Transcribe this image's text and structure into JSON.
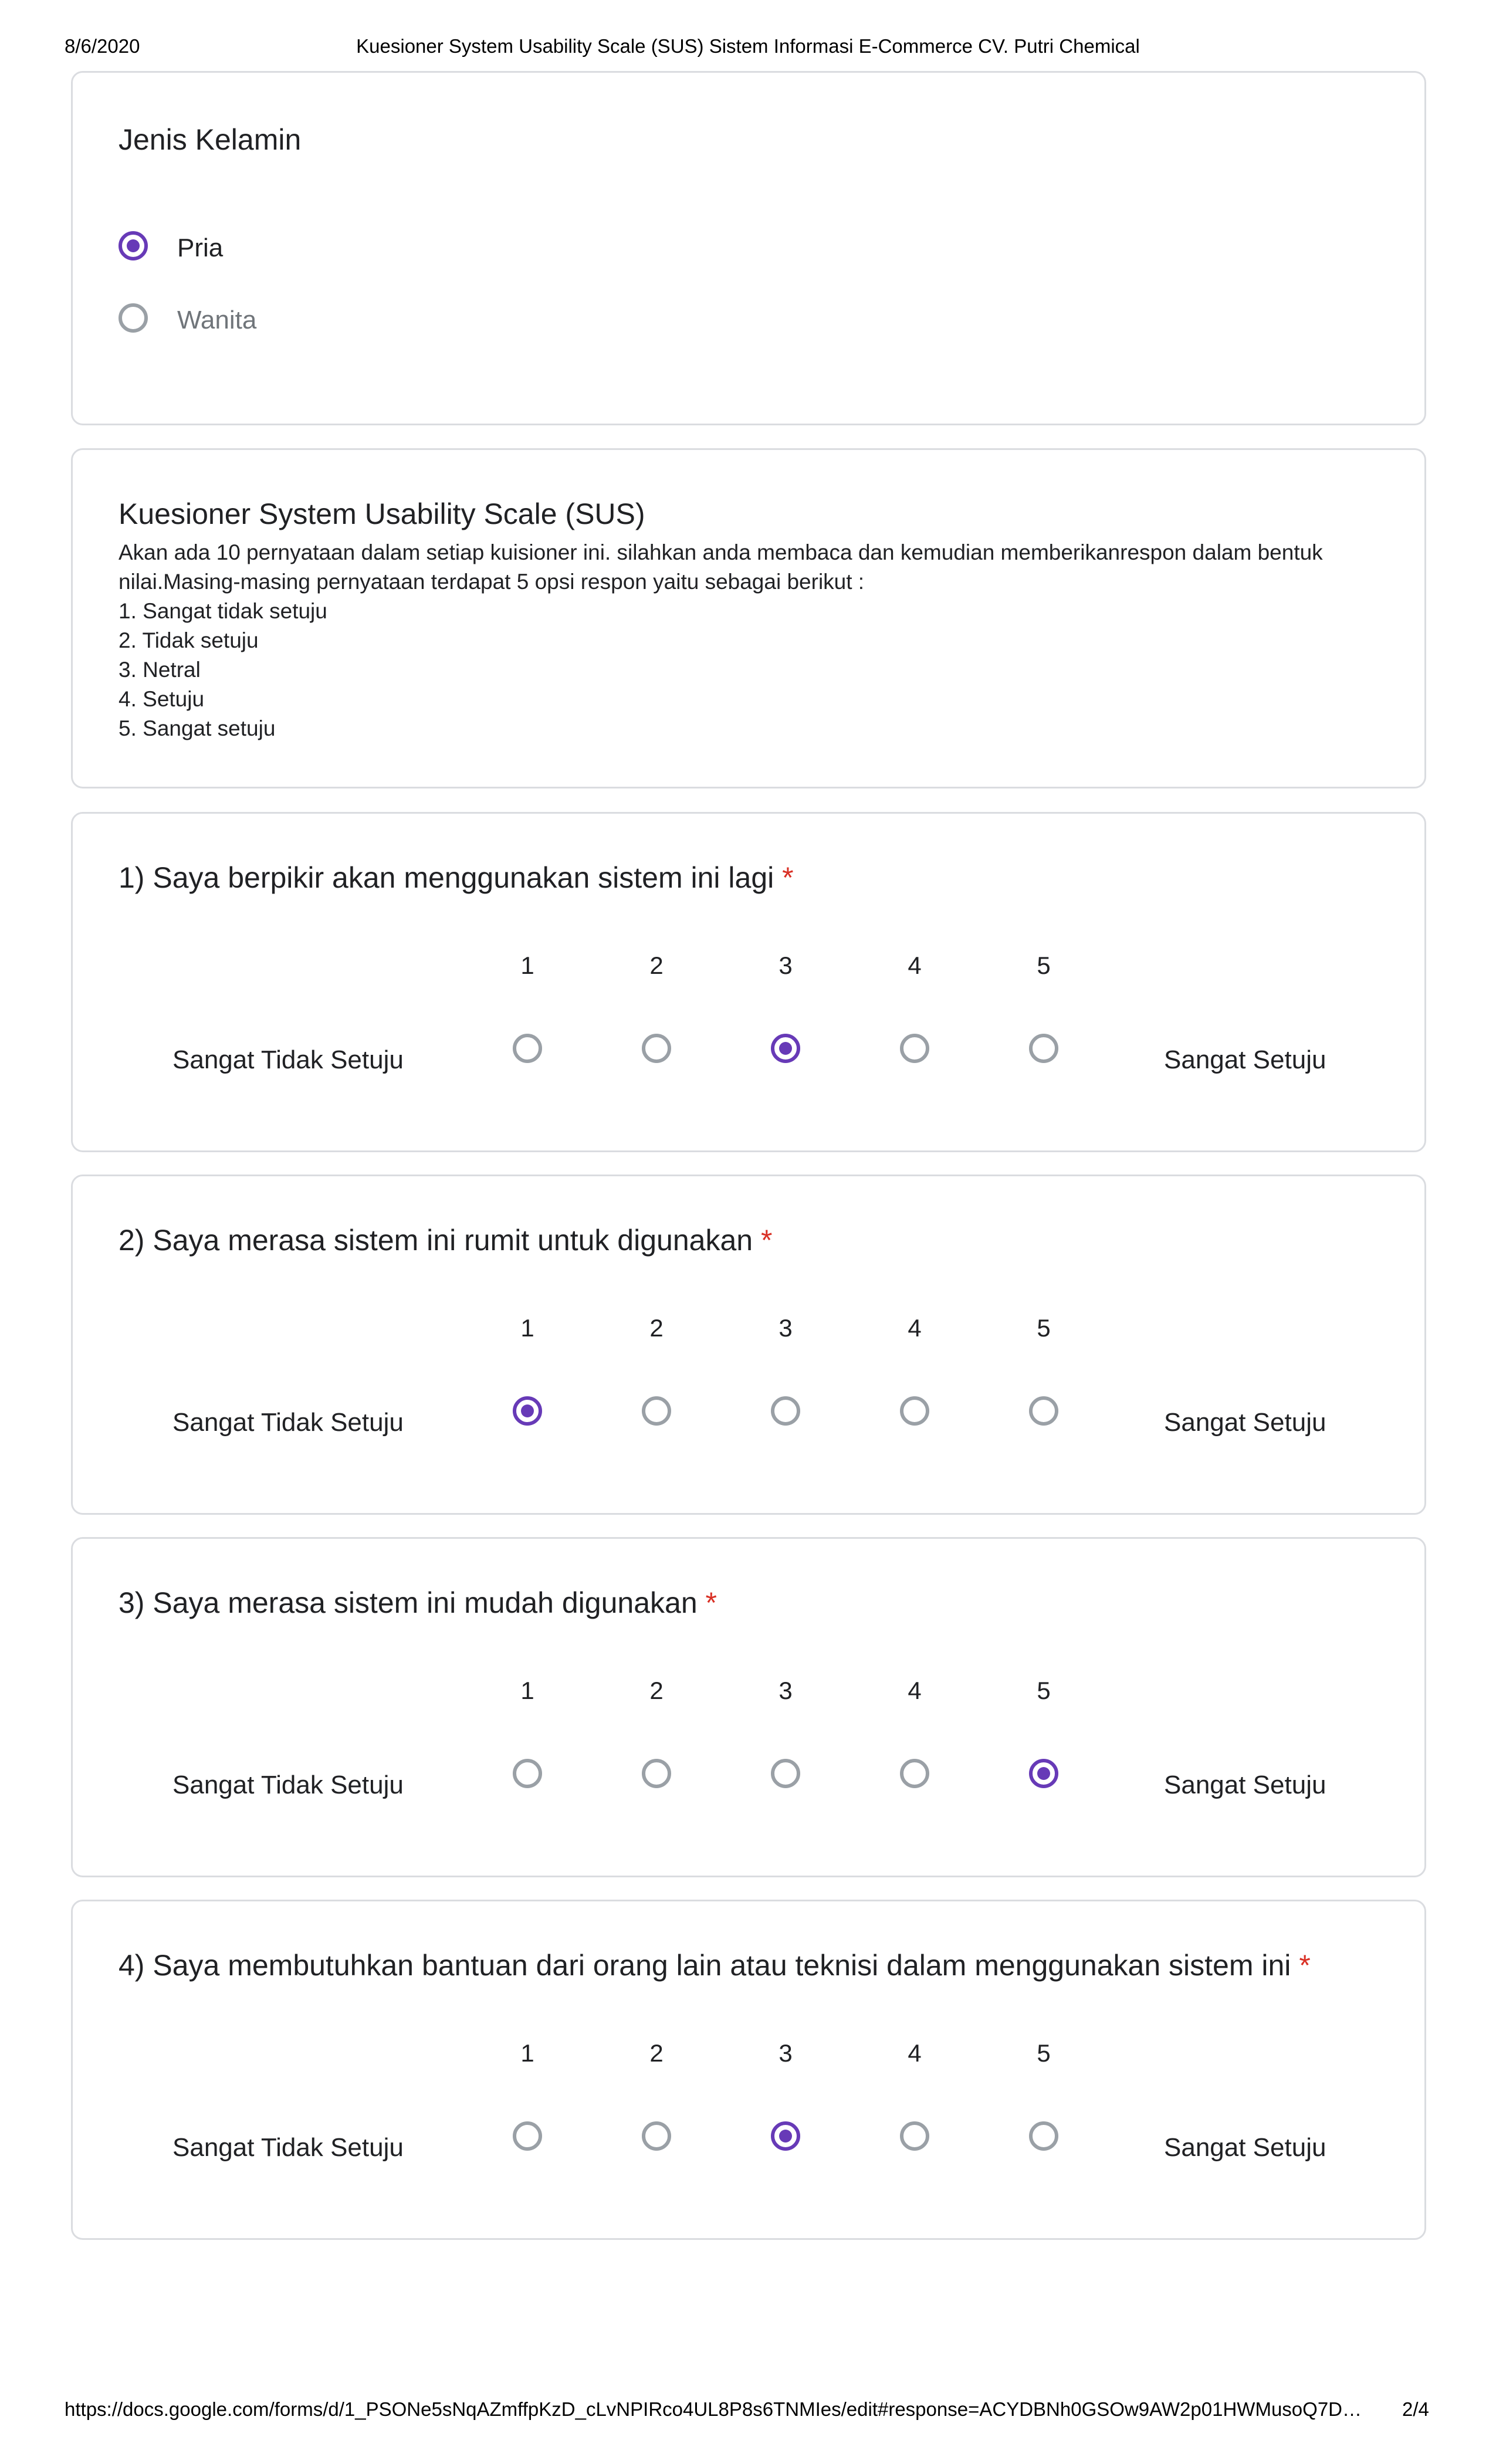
{
  "header": {
    "date": "8/6/2020",
    "title": "Kuesioner System Usability Scale (SUS) Sistem Informasi E-Commerce CV. Putri Chemical"
  },
  "gender": {
    "title": "Jenis Kelamin",
    "options": [
      {
        "label": "Pria",
        "selected": true
      },
      {
        "label": "Wanita",
        "selected": false
      }
    ]
  },
  "section": {
    "title": "Kuesioner System Usability Scale (SUS)",
    "description": "Akan ada 10 pernyataan dalam setiap kuisioner ini. silahkan anda membaca dan kemudian memberikanrespon dalam bentuk nilai.Masing-masing pernyataan terdapat 5 opsi respon yaitu sebagai berikut :\n1. Sangat tidak setuju\n2. Tidak setuju\n3. Netral\n4. Setuju\n5. Sangat setuju"
  },
  "scale": {
    "numbers": [
      "1",
      "2",
      "3",
      "4",
      "5"
    ],
    "low_label": "Sangat Tidak Setuju",
    "high_label": "Sangat Setuju"
  },
  "questions": [
    {
      "title": "1) Saya berpikir akan menggunakan sistem ini lagi",
      "required": "*",
      "selected": 3
    },
    {
      "title": "2) Saya merasa sistem ini rumit untuk digunakan",
      "required": "*",
      "selected": 1
    },
    {
      "title": "3) Saya merasa sistem ini mudah digunakan",
      "required": "*",
      "selected": 5
    },
    {
      "title": "4) Saya membutuhkan bantuan dari orang lain atau teknisi dalam menggunakan sistem ini",
      "required": "*",
      "selected": 3
    }
  ],
  "footer": {
    "url": "https://docs.google.com/forms/d/1_PSONe5sNqAZmffpKzD_cLvNPIRco4UL8P8s6TNMIes/edit#response=ACYDBNh0GSOw9AW2p01HWMusoQ7D…",
    "page": "2/4"
  },
  "colors": {
    "accent": "#673ab7",
    "required": "#d93025",
    "border": "#dadce0"
  }
}
